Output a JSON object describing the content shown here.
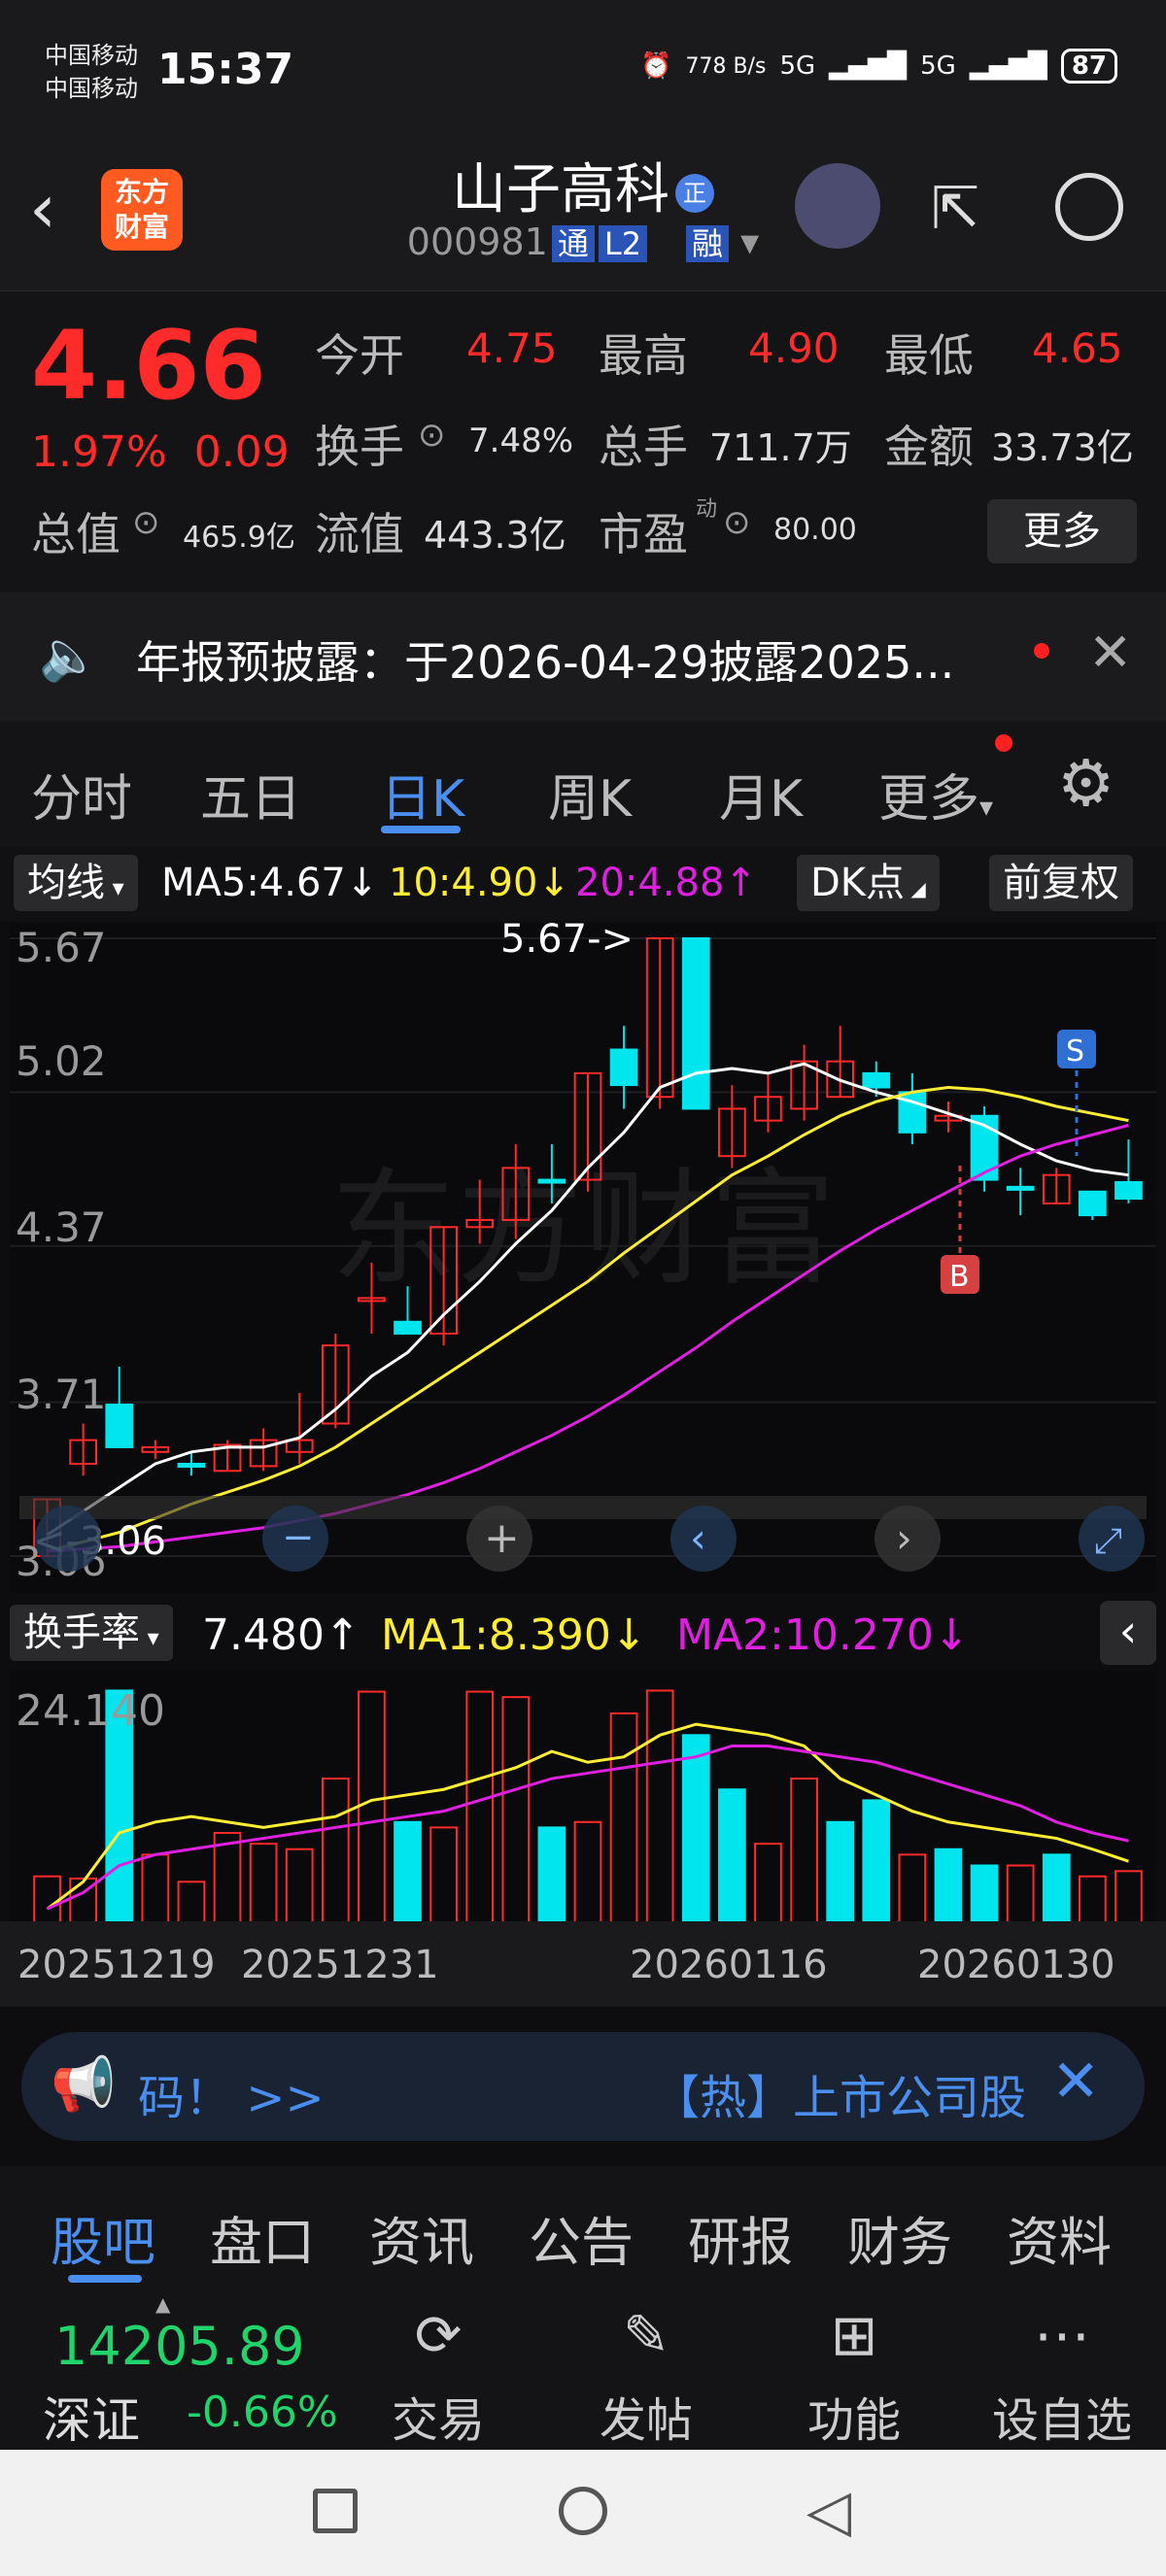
{
  "status_bar": {
    "carrier1": "中国移动",
    "carrier2": "中国移动",
    "time": "15:37",
    "net_speed": "778 B/s",
    "signal1": "5G",
    "signal2": "5G",
    "battery": "87"
  },
  "header": {
    "logo_text": "东方 财富",
    "stock_name": "山子高科",
    "cert_badge": "正",
    "code": "000981",
    "tag1": "通",
    "tag2": "L2",
    "tag3": "融"
  },
  "quote": {
    "price": "4.66",
    "change_pct": "1.97%",
    "change_amt": "0.09",
    "open_label": "今开",
    "open_value": "4.75",
    "high_label": "最高",
    "high_value": "4.90",
    "low_label": "最低",
    "low_value": "4.65",
    "turnover_label": "换手",
    "turnover_value": "7.48%",
    "volume_label": "总手",
    "volume_value": "711.7万",
    "amount_label": "金额",
    "amount_value": "33.73亿",
    "mktcap_label": "总值",
    "mktcap_value": "465.9亿",
    "float_label": "流值",
    "float_value": "443.3亿",
    "pe_label": "市盈",
    "pe_sup": "动",
    "pe_value": "80.00",
    "more_button": "更多"
  },
  "announcement": {
    "text": "年报预披露：于2026-04-29披露2025..."
  },
  "tabs": [
    "分时",
    "五日",
    "日K",
    "周K",
    "月K",
    "更多"
  ],
  "chart_toolbar": {
    "ma_select": "均线",
    "ma5": "MA5:4.67↓",
    "ma10": "10:4.90↓",
    "ma20": "20:4.88↑",
    "dk_button": "DK点",
    "fq_button": "前复权"
  },
  "chart_labels": {
    "y_top": "5.67",
    "y_2": "5.02",
    "y_3": "4.37",
    "y_4": "3.71",
    "y_bottom": "3.06",
    "max_annot": "5.67->",
    "min_annot": "<-3.06",
    "sell_badge": "S",
    "buy_badge": "B",
    "watermark": "东方财富"
  },
  "volume_header": {
    "select": "换手率",
    "value": "7.480↑",
    "ma1": "MA1:8.390↓",
    "ma2": "MA2:10.270↓",
    "y_top": "24.140"
  },
  "dates": [
    "20251219",
    "20251231",
    "20260116",
    "20260130"
  ],
  "promo": {
    "left_text": "码！ >>",
    "right_text": "【热】上市公司股"
  },
  "bottom_tabs": [
    "股吧",
    "盘口",
    "资讯",
    "公告",
    "研报",
    "财务",
    "资料"
  ],
  "bottom_nav": {
    "index_value": "14205.89",
    "index_name": "深证",
    "index_change": "-0.66%",
    "items": [
      "交易",
      "发帖",
      "功能",
      "设自选"
    ]
  },
  "colors": {
    "up": "#ff2a2a",
    "down": "#00e5ee",
    "ma5": "#ffffff",
    "ma10": "#ffee33",
    "ma20": "#e020e0",
    "accent": "#4a8ff0"
  },
  "chart_data": {
    "type": "candlestick",
    "y_range": [
      3.06,
      5.67
    ],
    "candles": [
      {
        "o": 3.06,
        "h": 3.3,
        "l": 3.06,
        "c": 3.3,
        "up": true
      },
      {
        "o": 3.55,
        "h": 3.62,
        "l": 3.4,
        "c": 3.45,
        "up": true
      },
      {
        "o": 3.7,
        "h": 3.86,
        "l": 3.52,
        "c": 3.52,
        "up": false
      },
      {
        "o": 3.5,
        "h": 3.55,
        "l": 3.47,
        "c": 3.52,
        "up": true
      },
      {
        "o": 3.45,
        "h": 3.5,
        "l": 3.4,
        "c": 3.45,
        "up": false
      },
      {
        "o": 3.42,
        "h": 3.55,
        "l": 3.42,
        "c": 3.53,
        "up": true
      },
      {
        "o": 3.44,
        "h": 3.6,
        "l": 3.42,
        "c": 3.55,
        "up": true
      },
      {
        "o": 3.5,
        "h": 3.75,
        "l": 3.45,
        "c": 3.55,
        "up": true
      },
      {
        "o": 3.62,
        "h": 4.0,
        "l": 3.6,
        "c": 3.95,
        "up": true
      },
      {
        "o": 4.15,
        "h": 4.3,
        "l": 4.0,
        "c": 4.15,
        "up": true
      },
      {
        "o": 4.05,
        "h": 4.2,
        "l": 4.0,
        "c": 4.0,
        "up": false
      },
      {
        "o": 4.0,
        "h": 4.45,
        "l": 3.95,
        "c": 4.45,
        "up": true
      },
      {
        "o": 4.45,
        "h": 4.65,
        "l": 4.38,
        "c": 4.48,
        "up": true
      },
      {
        "o": 4.48,
        "h": 4.8,
        "l": 4.4,
        "c": 4.7,
        "up": true
      },
      {
        "o": 4.65,
        "h": 4.8,
        "l": 4.55,
        "c": 4.65,
        "up": false
      },
      {
        "o": 4.65,
        "h": 5.1,
        "l": 4.6,
        "c": 5.1,
        "up": true
      },
      {
        "o": 5.2,
        "h": 5.3,
        "l": 4.95,
        "c": 5.05,
        "up": false
      },
      {
        "o": 5.0,
        "h": 5.67,
        "l": 4.95,
        "c": 5.67,
        "up": true
      },
      {
        "o": 5.67,
        "h": 5.67,
        "l": 4.95,
        "c": 4.95,
        "up": false
      },
      {
        "o": 4.75,
        "h": 5.05,
        "l": 4.7,
        "c": 4.95,
        "up": true
      },
      {
        "o": 4.9,
        "h": 5.1,
        "l": 4.85,
        "c": 5.0,
        "up": true
      },
      {
        "o": 4.95,
        "h": 5.22,
        "l": 4.9,
        "c": 5.15,
        "up": true
      },
      {
        "o": 5.15,
        "h": 5.3,
        "l": 5.0,
        "c": 5.0,
        "up": true
      },
      {
        "o": 5.1,
        "h": 5.15,
        "l": 5.0,
        "c": 5.04,
        "up": false
      },
      {
        "o": 5.02,
        "h": 5.1,
        "l": 4.8,
        "c": 4.85,
        "up": false
      },
      {
        "o": 4.92,
        "h": 4.98,
        "l": 4.85,
        "c": 4.9,
        "up": true
      },
      {
        "o": 4.92,
        "h": 4.96,
        "l": 4.6,
        "c": 4.65,
        "up": false
      },
      {
        "o": 4.62,
        "h": 4.7,
        "l": 4.5,
        "c": 4.62,
        "up": false
      },
      {
        "o": 4.55,
        "h": 4.7,
        "l": 4.55,
        "c": 4.67,
        "up": true
      },
      {
        "o": 4.6,
        "h": 4.6,
        "l": 4.48,
        "c": 4.5,
        "up": false
      },
      {
        "o": 4.64,
        "h": 4.82,
        "l": 4.55,
        "c": 4.57,
        "up": false
      }
    ],
    "ma5": [
      3.15,
      3.25,
      3.35,
      3.45,
      3.5,
      3.52,
      3.52,
      3.56,
      3.68,
      3.82,
      3.92,
      4.08,
      4.22,
      4.38,
      4.52,
      4.7,
      4.85,
      5.04,
      5.1,
      5.12,
      5.1,
      5.14,
      5.07,
      5.02,
      4.98,
      4.93,
      4.88,
      4.8,
      4.73,
      4.69,
      4.67
    ],
    "ma10": [
      3.08,
      3.12,
      3.16,
      3.22,
      3.28,
      3.33,
      3.38,
      3.44,
      3.52,
      3.62,
      3.72,
      3.82,
      3.92,
      4.02,
      4.12,
      4.22,
      4.34,
      4.45,
      4.56,
      4.67,
      4.75,
      4.84,
      4.92,
      4.98,
      5.02,
      5.04,
      5.03,
      5.0,
      4.96,
      4.93,
      4.9
    ],
    "ma20": [
      3.08,
      3.09,
      3.1,
      3.12,
      3.14,
      3.16,
      3.18,
      3.21,
      3.24,
      3.28,
      3.32,
      3.37,
      3.43,
      3.5,
      3.57,
      3.65,
      3.74,
      3.84,
      3.94,
      4.05,
      4.15,
      4.25,
      4.35,
      4.44,
      4.52,
      4.6,
      4.68,
      4.75,
      4.8,
      4.84,
      4.88
    ],
    "turnover": [
      7.0,
      6.8,
      24.1,
      9.0,
      6.5,
      11.0,
      10.0,
      9.5,
      16.0,
      24.0,
      12.0,
      11.5,
      24.0,
      23.5,
      11.5,
      12.0,
      22.0,
      24.1,
      20.0,
      15.0,
      10.0,
      16.0,
      12.0,
      14.0,
      9.0,
      9.5,
      8.0,
      8.0,
      9.0,
      7.0,
      7.48
    ],
    "turnover_ma1": [
      4.0,
      6.5,
      11.0,
      12.0,
      12.5,
      12.0,
      11.5,
      12.0,
      12.5,
      14.0,
      14.5,
      15.0,
      16.0,
      17.0,
      18.5,
      17.5,
      18.0,
      20.0,
      21.0,
      20.5,
      20.0,
      19.0,
      16.0,
      14.5,
      13.0,
      12.0,
      11.5,
      11.0,
      10.5,
      9.5,
      8.39
    ],
    "turnover_ma2": [
      4.0,
      5.5,
      8.0,
      9.0,
      9.5,
      10.0,
      10.5,
      11.0,
      11.5,
      12.0,
      12.5,
      13.0,
      14.0,
      15.0,
      16.0,
      16.5,
      17.0,
      17.5,
      18.0,
      19.0,
      19.0,
      18.5,
      18.0,
      17.5,
      16.5,
      15.5,
      14.5,
      13.5,
      12.0,
      11.0,
      10.27
    ],
    "turnover_up": [
      true,
      true,
      false,
      true,
      true,
      true,
      true,
      true,
      true,
      true,
      false,
      true,
      true,
      true,
      false,
      true,
      true,
      true,
      false,
      false,
      true,
      true,
      false,
      false,
      true,
      false,
      false,
      true,
      false,
      true,
      true
    ]
  }
}
